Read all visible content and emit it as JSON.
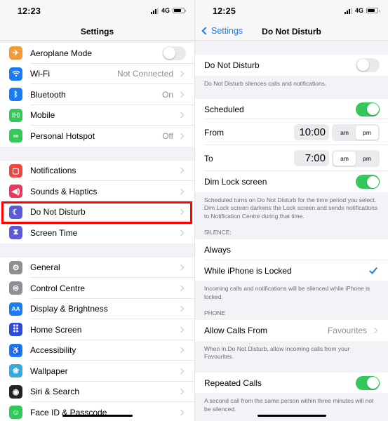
{
  "left": {
    "status": {
      "time": "12:23",
      "network": "4G"
    },
    "title": "Settings",
    "groups": [
      [
        {
          "id": "aeroplane",
          "label": "Aeroplane Mode",
          "icon": "airplane-icon",
          "color": "#f19a37",
          "glyph": "✈",
          "toggle": false
        },
        {
          "id": "wifi",
          "label": "Wi-Fi",
          "icon": "wifi-icon",
          "color": "#1a7cf5",
          "glyph": "",
          "value": "Not Connected"
        },
        {
          "id": "bluetooth",
          "label": "Bluetooth",
          "icon": "bluetooth-icon",
          "color": "#1a7cf5",
          "glyph": "ᛒ",
          "value": "On"
        },
        {
          "id": "mobile",
          "label": "Mobile",
          "icon": "antenna-icon",
          "color": "#34c759",
          "glyph": "((•))",
          "value": ""
        },
        {
          "id": "hotspot",
          "label": "Personal Hotspot",
          "icon": "hotspot-icon",
          "color": "#34c759",
          "glyph": "∞",
          "value": "Off"
        }
      ],
      [
        {
          "id": "notifications",
          "label": "Notifications",
          "icon": "notifications-icon",
          "color": "#f2453d",
          "glyph": "▢",
          "value": ""
        },
        {
          "id": "sounds",
          "label": "Sounds & Haptics",
          "icon": "speaker-icon",
          "color": "#f0365c",
          "glyph": "◀)",
          "value": ""
        },
        {
          "id": "dnd",
          "label": "Do Not Disturb",
          "icon": "moon-icon",
          "color": "#5c5ad6",
          "glyph": "☾",
          "value": ""
        },
        {
          "id": "screentime",
          "label": "Screen Time",
          "icon": "hourglass-icon",
          "color": "#5c5ad6",
          "glyph": "⧗",
          "value": ""
        }
      ],
      [
        {
          "id": "general",
          "label": "General",
          "icon": "gear-icon",
          "color": "#8e8e93",
          "glyph": "⚙",
          "value": ""
        },
        {
          "id": "control",
          "label": "Control Centre",
          "icon": "switches-icon",
          "color": "#8e8e93",
          "glyph": "⊜",
          "value": ""
        },
        {
          "id": "display",
          "label": "Display & Brightness",
          "icon": "text-size-icon",
          "color": "#1a7cf5",
          "glyph": "AA",
          "value": ""
        },
        {
          "id": "home",
          "label": "Home Screen",
          "icon": "app-grid-icon",
          "color": "#2f4bd8",
          "glyph": "⠿",
          "value": ""
        },
        {
          "id": "accessibility",
          "label": "Accessibility",
          "icon": "accessibility-icon",
          "color": "#1a7cf5",
          "glyph": "♿",
          "value": ""
        },
        {
          "id": "wallpaper",
          "label": "Wallpaper",
          "icon": "flower-icon",
          "color": "#37aadc",
          "glyph": "❀",
          "value": ""
        },
        {
          "id": "siri",
          "label": "Siri & Search",
          "icon": "siri-icon",
          "color": "#222",
          "glyph": "◉",
          "value": ""
        },
        {
          "id": "faceid",
          "label": "Face ID & Passcode",
          "icon": "face-id-icon",
          "color": "#34c759",
          "glyph": "☺",
          "value": ""
        }
      ]
    ]
  },
  "right": {
    "status": {
      "time": "12:25",
      "network": "4G"
    },
    "back_label": "Settings",
    "title": "Do Not Disturb",
    "dnd": {
      "label": "Do Not Disturb",
      "on": false,
      "footnote": "Do Not Disturb silences calls and notifications."
    },
    "scheduled": {
      "label": "Scheduled",
      "on": true
    },
    "from": {
      "label": "From",
      "time": "10:00",
      "am": "am",
      "pm": "pm",
      "selected": "pm"
    },
    "to": {
      "label": "To",
      "time": "7:00",
      "am": "am",
      "pm": "pm",
      "selected": "am"
    },
    "dim": {
      "label": "Dim Lock screen",
      "on": true,
      "footnote": "Scheduled turns on Do Not Disturb for the time period you select. Dim Lock screen darkens the Lock screen and sends notifications to Notification Centre during that time."
    },
    "silence": {
      "header": "SILENCE:",
      "options": [
        {
          "label": "Always",
          "checked": false
        },
        {
          "label": "While iPhone is Locked",
          "checked": true
        }
      ],
      "footnote": "Incoming calls and notifications will be silenced while iPhone is locked."
    },
    "phone": {
      "header": "PHONE",
      "allow_label": "Allow Calls From",
      "allow_value": "Favourites",
      "allow_footnote": "When in Do Not Disturb, allow incoming calls from your Favourites.",
      "repeated_label": "Repeated Calls",
      "repeated_on": true,
      "repeated_footnote": "A second call from the same person within three minutes will not be silenced."
    }
  },
  "highlight": {
    "target": "dnd",
    "color": "#ff0000"
  }
}
